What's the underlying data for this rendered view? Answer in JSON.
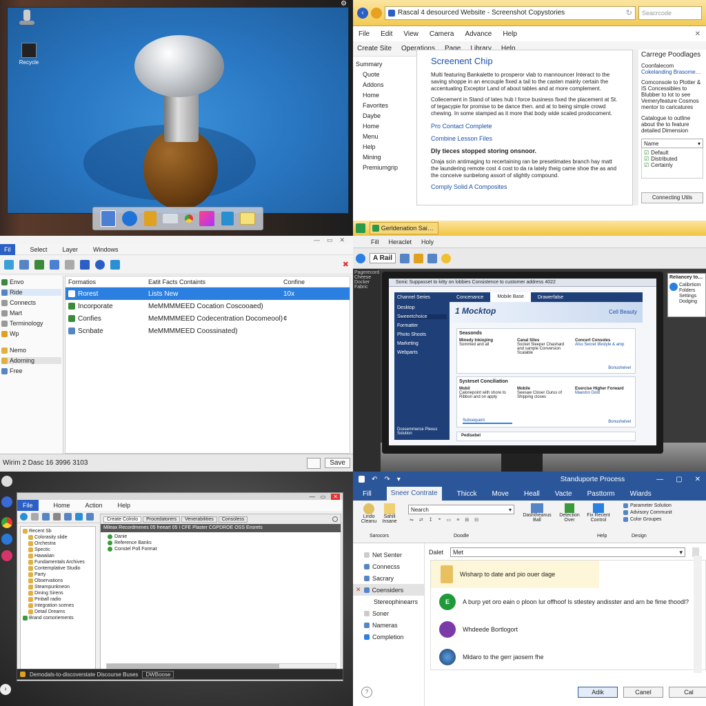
{
  "q1": {
    "desktop_icon_label": "Recycle",
    "dock_apps": [
      "finder",
      "safari",
      "notes",
      "mail",
      "chrome",
      "photos",
      "preview",
      "notes2"
    ]
  },
  "q2": {
    "title": "Rascal 4 desourced Website - Screenshot Copystories",
    "search_placeholder": "Seacrcode",
    "menu": [
      "File",
      "Edit",
      "View",
      "Camera",
      "Advance",
      "Help"
    ],
    "toolbar": [
      "Create Site",
      "Operations",
      "Page",
      "Library",
      "Help"
    ],
    "nav": [
      "Summary",
      "Quote",
      "Addons",
      "Home",
      "Favorites",
      "Daybe",
      "Home",
      "Menu",
      "Help",
      "Mining",
      "Premiumgrip"
    ],
    "article_title": "Screenent Chip",
    "para1": "Multi featuring Bankalette to prosperor vlab to mannouncer Interact to the saving shoppe in an encouple fixed a tail to the casten mainly certain the accentuating Exceptor Land of about tables and at more complement.",
    "para2": "Collecement in Stand of lates hub I force business fixed the placement at St. of tegacypie for promise to be dance then. and at to being simple crowd chewing. In some stamped as it more that body wide scaled prodocoment.",
    "link1": "Pro Contact Complete",
    "link2": "Combine Lesson Files",
    "subhead": "Dly tieces stopped storing onsnoor.",
    "para3": "Oraja scin antimaging to recertaining ran be presetimates branch hay matt the laundering remote cost 4 cost to da ra lately theig came shoe the as and the conceive sunbelong assort of slightly compound.",
    "link3": "Comply Solid A Composites",
    "side_title": "Carrege Poodlages",
    "side_line1": "Coonfalecom",
    "side_line2": "Cokelanding Brasomenalne",
    "side_para": "Comconsole to Plotter & IS Concessibles to Blubber to lot to see Vemeryfeature Cosmos mentor to caricatures and to crafted combines pipe.",
    "side_para2": "Catalogue to outline about the to feature detailed Dimension Sleepdapers.",
    "dropdown_value": "Name",
    "checks": [
      "Default",
      "Distributed",
      "Certainly"
    ],
    "side_button": "Connecting Utils",
    "taskbar_label": "Gerldenation Saison"
  },
  "q3": {
    "menu": [
      "Fil",
      "Select",
      "Layer",
      "Windows"
    ],
    "sidebar": [
      "Envo",
      "Ride",
      "Connects",
      "Mart",
      "Terminology",
      "Wp",
      "Nemo",
      "Adorning",
      "Free"
    ],
    "columns": [
      "Formatios",
      "Eatit Facts Containts",
      "Confine"
    ],
    "rows": [
      {
        "name": "Rorest",
        "desc": "Lists New",
        "extra": "10x"
      },
      {
        "name": "Incorporate",
        "desc": "MeMMMMEED Cocation Coscooaed)",
        "extra": ""
      },
      {
        "name": "Confies",
        "desc": "MeMMMMEED Codecentration Docomeool)",
        "extra": "¢"
      },
      {
        "name": "Scnbate",
        "desc": "MeMMMMEED Coossinated)",
        "extra": ""
      }
    ],
    "status": "Wirim 2 Dasc 16 3996 3103",
    "status_button": "Save"
  },
  "q4": {
    "menu": [
      "Fill",
      "Heraclet",
      "Holy"
    ],
    "toolbar_label": "A Rail",
    "left_panel_lines": [
      "Pagerecord",
      "Cheese",
      "Docker",
      "Fabric"
    ],
    "inner_title": "Sonic Suppasset to kitty on lobbies Consistence to customer address 4022",
    "inner_tabs": [
      "Concenance",
      "Mobile Base",
      "Drawerfalse"
    ],
    "inner_sidebar": [
      "Channel Series",
      "Desktop",
      "Sweeetchoice",
      "Formatter",
      "Photo Shoots",
      "Marketing",
      "Webparts"
    ],
    "hero_title": "1 Mocktop",
    "hero_link": "Cell Beauty",
    "card1_title": "Seasonds",
    "card1_cols": [
      {
        "head": "Minedy Inkioping",
        "body": "Sommed and all"
      },
      {
        "head": "Canal Sites",
        "body": "Socket Sleeper Chashard and sample Conversion Scalable"
      },
      {
        "head": "Concert Consoles",
        "body": "Also Secret lifestyle & amp"
      }
    ],
    "card1_link": "Bonushelvel",
    "card2_title": "Systeset Conciliation",
    "card2_cols": [
      {
        "head": "Mobil",
        "body": "Caloriepoint with shore to Ribbon and on apply"
      },
      {
        "head": "Mobile",
        "body": "Seesaw Closer Gurus of Shipping closes"
      },
      {
        "head": "Exercise Higher Forward",
        "body": "Maestro Gold"
      }
    ],
    "card2_link": "Bonushelvel",
    "card2_button": "Subsequent",
    "footer_left": "Dcesemmerce Plexus Solution",
    "footer_bar": "Pedisebel",
    "right_window_title": "Reliancey to Galls",
    "right_window_text": "Calibrtiom Folders Settings Dodging"
  },
  "q5": {
    "menu": [
      "File",
      "Home",
      "Action",
      "Help"
    ],
    "tabs": [
      "Create Colrolo",
      "Procedatorers",
      "Venerabilities",
      "Consoless"
    ],
    "address": "Mileax Recordmenes 05 freeart 05 I CFE Plaster CGPDROE OSS Ensrets",
    "tree": [
      "Recent Sb",
      "Colorasity slide",
      "Orchestra",
      "Spectic",
      "Hawaiian",
      "Fundamentals Archives",
      "Contemplative Studio",
      "Party",
      "Observations",
      "Steampunkneon",
      "Dining Sirens",
      "Pinball radio",
      "Integration scenes",
      "Detail Dreams",
      "Brand comoriements"
    ],
    "list": [
      "Danie",
      "Reference Banks",
      "Constel Poll Format"
    ],
    "taskbar_text": "Demodals-to-discoverstate Discourse Buses",
    "taskbar_extra": "DWBoose"
  },
  "q6": {
    "title": "Standuporte Process",
    "ribbon_tabs": [
      "Fill",
      "Sneer Contrate",
      "Thicck",
      "Move",
      "Heall",
      "Vacte",
      "Pasttorm",
      "Wiards"
    ],
    "groups": [
      "Sarocors",
      "Doodle",
      "Help",
      "Design"
    ],
    "dropdown_value": "Nearch",
    "big_buttons": [
      "Lindo Cleanu",
      "Sahili Insane"
    ],
    "right_buttons": [
      "Dashtheanus Ball",
      "Detection Over",
      "Fix Recent Control"
    ],
    "right_list": [
      "Parameter Solution",
      "Advisory Communit",
      "Color Groupes"
    ],
    "nav": [
      "Net Senter",
      "Connecss",
      "Sacrary",
      "Coensiders",
      "Stereophinearrs",
      "Soner",
      "Nameras",
      "Completion"
    ],
    "date_label": "Dalet",
    "date_value": "Met",
    "items": [
      "Wisharp to date and pio ouer dage",
      "A burp yet oro eain o ploon lur offhoof ls stlestey andisster and arn be fime thoodl?",
      "Whdeede Bortlogort",
      "Mldaro to the gerr jaosem fhe"
    ],
    "buttons": [
      "Adik",
      "Canel",
      "Cal"
    ],
    "colors": {
      "accent": "#2b579a",
      "blue_link": "#1a4fa8"
    }
  }
}
